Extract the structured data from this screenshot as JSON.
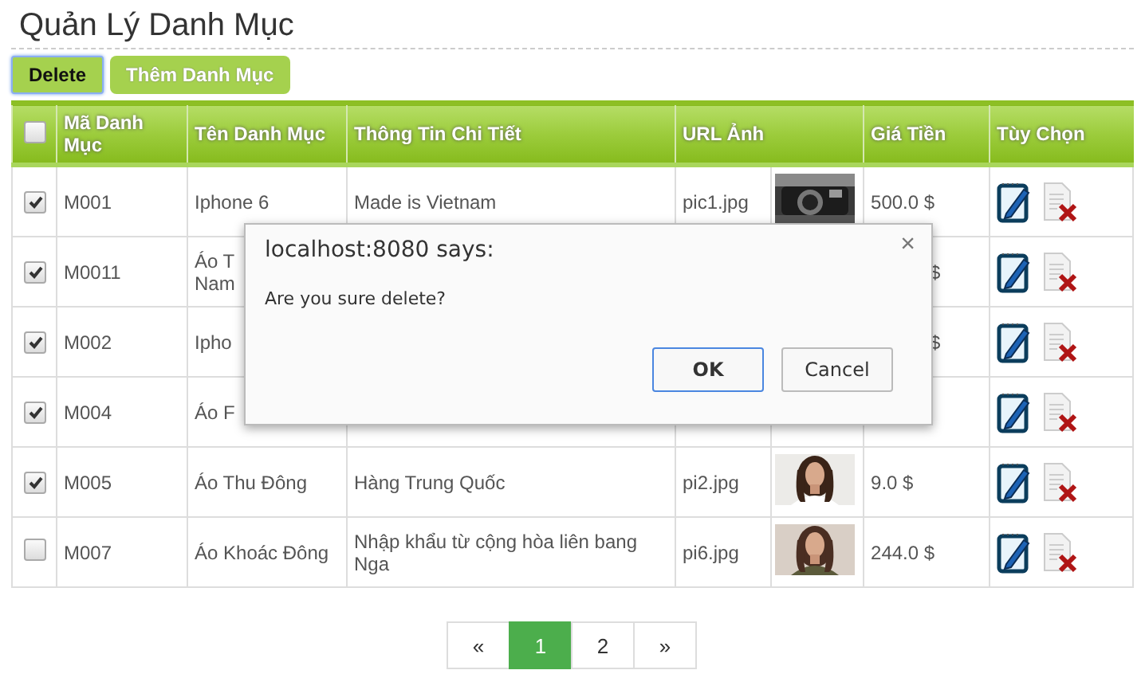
{
  "page": {
    "title": "Quản Lý Danh Mục"
  },
  "toolbar": [
    {
      "label": "Delete",
      "focused": true
    },
    {
      "label": "Thêm Danh Mục",
      "focused": false
    }
  ],
  "table": {
    "select_all": {
      "checked": false
    },
    "columns": [
      "Mã Danh Mục",
      "Tên Danh Mục",
      "Thông Tin Chi Tiết",
      "URL Ảnh",
      "Giá Tiền",
      "Tùy Chọn"
    ],
    "rows": [
      {
        "checked": true,
        "code": "M001",
        "name": "Iphone 6",
        "detail": "Made is Vietnam",
        "url": "pic1.jpg",
        "price": "500.0 $",
        "price_cut": false
      },
      {
        "checked": true,
        "code": "M0011",
        "name": "Áo T\nNam",
        "price": "$",
        "price_cut": true
      },
      {
        "checked": true,
        "code": "M002",
        "name": "Ipho",
        "price": "$",
        "price_cut": true
      },
      {
        "checked": true,
        "code": "M004",
        "name": "Áo F"
      },
      {
        "checked": true,
        "code": "M005",
        "name": "Áo Thu Đông",
        "detail": "Hàng Trung Quốc",
        "url": "pi2.jpg",
        "price": "9.0 $",
        "price_cut": false
      },
      {
        "checked": false,
        "code": "M007",
        "name": "Áo Khoác Đông",
        "detail": "Nhập khẩu từ cộng hòa liên bang Nga",
        "url": "pi6.jpg",
        "price": "244.0 $",
        "price_cut": false
      }
    ]
  },
  "pagination": [
    {
      "label": "«",
      "selected": false
    },
    {
      "label": "1",
      "selected": true
    },
    {
      "label": "2",
      "selected": false
    },
    {
      "label": "»",
      "selected": false
    }
  ],
  "dialog": {
    "title": "localhost:8080 says:",
    "message": "Are you sure delete?",
    "close": "×",
    "buttons": [
      {
        "label": "OK",
        "focused": true
      },
      {
        "label": "Cancel",
        "focused": false
      }
    ]
  }
}
